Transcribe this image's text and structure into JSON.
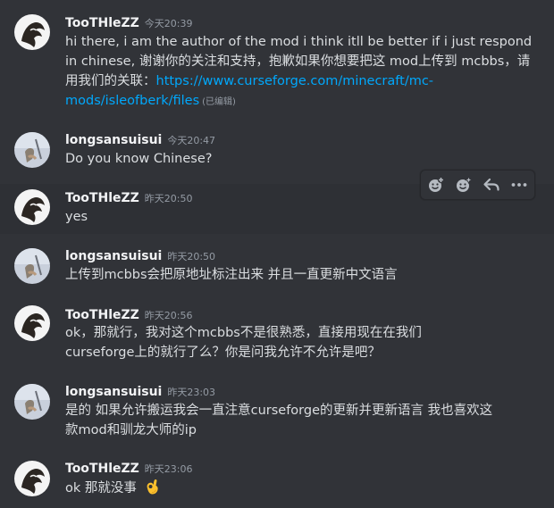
{
  "messages": [
    {
      "username": "TooTHleZZ",
      "timestamp": "今天20:39",
      "lines": [
        "hi there, i am the author of the mod i think itll be better if i just respond in chinese, 谢谢你的关注和支持，抱歉如果你想要把这 mod上传到 mcbbs，请用我们的关联："
      ],
      "link": "https://www.curseforge.com/minecraft/mc-mods/isleofberk/files",
      "edited": "(已编辑)"
    },
    {
      "username": "longsansuisui",
      "timestamp": "今天20:47",
      "text": "Do you know Chinese?"
    },
    {
      "username": "TooTHleZZ",
      "timestamp": "昨天20:50",
      "text": "yes"
    },
    {
      "username": "longsansuisui",
      "timestamp": "昨天20:50",
      "text": "上传到mcbbs会把原地址标注出来 并且一直更新中文语言"
    },
    {
      "username": "TooTHleZZ",
      "timestamp": "昨天20:56",
      "text": "ok，那就行，我对这个mcbbs不是很熟悉，直接用现在在我们curseforge上的就行了么？你是问我允许不允许是吧？"
    },
    {
      "username": "longsansuisui",
      "timestamp": "昨天23:03",
      "text": "是的 如果允许搬运我会一直注意curseforge的更新并更新语言 我也喜欢这款mod和驯龙大师的ip"
    },
    {
      "username": "TooTHleZZ",
      "timestamp": "昨天23:06",
      "text": "ok 那就没事",
      "emoji": "ok-hand-emoji"
    }
  ],
  "toolbar": {
    "icons": [
      "add-reaction-icon",
      "super-reaction-icon",
      "reply-icon",
      "more-icon"
    ]
  },
  "colors": {
    "background": "#313338",
    "username": "#f2f3f5",
    "timestamp": "#949ba4",
    "text": "#dbdee1",
    "link": "#00a8fc"
  }
}
